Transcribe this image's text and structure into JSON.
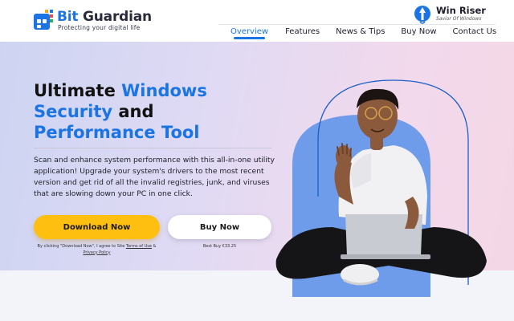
{
  "brand": {
    "name_part1": "Bit",
    "name_part2": "Guardian",
    "tagline": "Protecting your digital life"
  },
  "product": {
    "title": "Win Riser",
    "subtitle": "Savior Of Windows"
  },
  "nav": {
    "items": [
      {
        "label": "Overview",
        "active": true
      },
      {
        "label": "Features"
      },
      {
        "label": "News & Tips"
      },
      {
        "label": "Buy Now"
      },
      {
        "label": "Contact Us"
      }
    ]
  },
  "hero": {
    "title_part1": "Ultimate ",
    "title_part2": "Windows",
    "title_part3": "Security",
    "title_part4": " and",
    "title_part5": "Performance Tool",
    "description": "Scan and enhance system performance with this all-in-one utility application! Upgrade your system's drivers to the most recent version and get rid of all the invalid registries, junk, and viruses that are slowing down your PC in one click.",
    "download_label": "Download Now",
    "buy_label": "Buy Now",
    "download_note_prefix": "By clicking \"Download Now\", I agree to Site ",
    "terms_link": "Terms of Use",
    "note_amp": " & ",
    "privacy_link": "Privacy Policy",
    "price_note": "Best Buy €33.25"
  },
  "colors": {
    "accent": "#1b74e4",
    "download_button": "#ffbf10",
    "arch": "#6e9bea"
  },
  "icons": [
    "bit-guardian-logo-icon",
    "win-riser-rocket-icon"
  ]
}
